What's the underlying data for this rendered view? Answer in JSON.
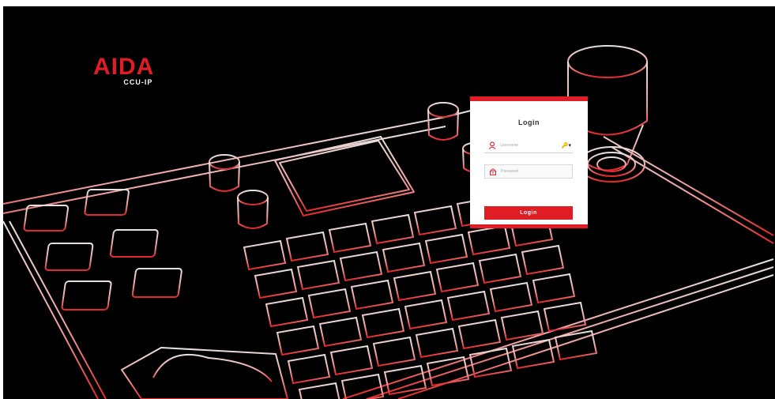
{
  "brand": {
    "name": "AIDA",
    "product": "CCU-IP",
    "accent_color": "#e01c24"
  },
  "background": {
    "description_icon": "ptz-controller-keyboard-illustration"
  },
  "login": {
    "title": "Login",
    "username": {
      "placeholder": "Username",
      "icon": "user-icon",
      "menu_icon": "key-dropdown-icon",
      "menu_label": "🔑▾"
    },
    "password": {
      "placeholder": "Password",
      "icon": "lock-icon"
    },
    "submit_label": "Login"
  }
}
